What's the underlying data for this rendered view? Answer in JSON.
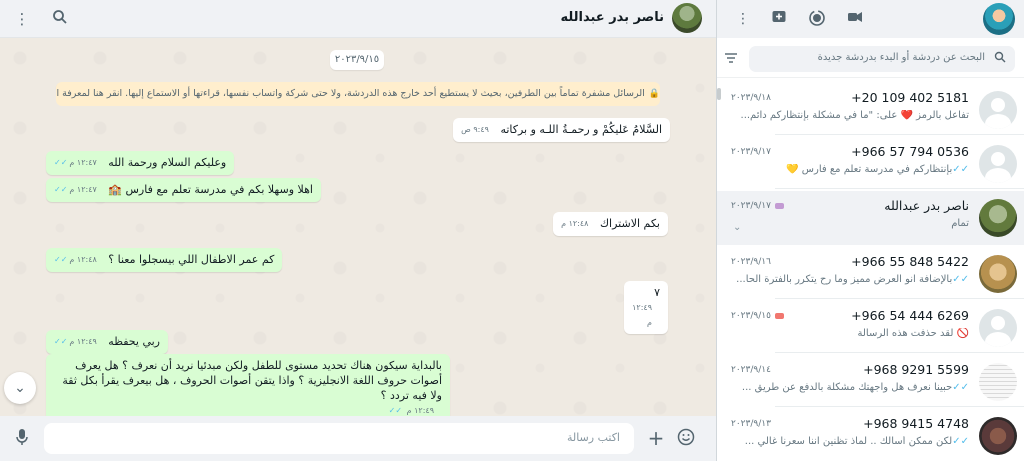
{
  "chat": {
    "contact_name": "ناصر بدر عبدالله",
    "date_chip": "٢٠٢٣/٩/١٥",
    "encryption_notice": "الرسائل مشفرة تماماً بين الطرفين، بحيث لا يستطيع أحد خارج هذه الدردشة، ولا حتى شركة واتساب نفسها، قراءتها أو الاستماع إليها. انقر هنا لمعرفة المزيد.",
    "messages": [
      {
        "dir": "in",
        "text": "السَّلامُ عَليكُمْ و رحمـةُ اللـه و بركاته",
        "time": "٩:٤٩ ص"
      },
      {
        "dir": "out",
        "text": "وعليكم السلام ورحمة الله",
        "time": "١٢:٤٧ م"
      },
      {
        "dir": "out",
        "text": "اهلا وسهلا بكم في مدرسة تعلم مع فارس 🏫",
        "time": "١٢:٤٧ م"
      },
      {
        "dir": "in",
        "text": "بكم الاشتراك",
        "time": "١٢:٤٨ م"
      },
      {
        "dir": "out",
        "text": "كم عمر الاطفال اللي بيسجلوا معنا ؟",
        "time": "١٢:٤٨ م"
      },
      {
        "dir": "in",
        "text": "٧",
        "time": "١٢:٤٩ م"
      },
      {
        "dir": "out",
        "text": "ربي يحفظه",
        "time": "١٢:٤٩ م"
      },
      {
        "dir": "out",
        "text": "بالبداية سيكون هناك تحديد مستوى للطفل ولكن مبدئيا نريد أن نعرف ؟ هل يعرف أصوات حروف اللغة الانجليزية ؟ واذا يتقن أصوات الحروف ، هل بيعرف يقرأ بكل ثقة ولا فيه تردد ؟",
        "time": "١٢:٤٩ م"
      }
    ],
    "composer_placeholder": "اكتب رسالة"
  },
  "list": {
    "search_placeholder": "البحث عن دردشة أو البدء بدردشة جديدة",
    "chats": [
      {
        "name": "+20 109 402 5181",
        "date": "٢٠٢٣/٩/١٨",
        "preview": "تفاعل بالرمز ❤️ على: \"ما في مشكلة بإنتظاركم دائم...",
        "tick": false,
        "avatar": "default",
        "tag": ""
      },
      {
        "name": "+966 57 794 0536",
        "date": "٢٠٢٣/٩/١٧",
        "preview": "بإنتظاركم في مدرسة تعلم مع فارس 💛",
        "tick": true,
        "avatar": "default",
        "tag": ""
      },
      {
        "name": "ناصر بدر عبدالله",
        "date": "٢٠٢٣/٩/١٧",
        "preview": "تمام",
        "tick": false,
        "avatar": "pic1",
        "tag": "#c39bd3",
        "active": true
      },
      {
        "name": "+966 55 848 5422",
        "date": "٢٠٢٣/٩/١٦",
        "preview": "بالإضافة انو العرض مميز وما رح يتكرر بالفترة الحا...",
        "tick": true,
        "avatar": "pic2",
        "tag": ""
      },
      {
        "name": "+966 54 444 6269",
        "date": "٢٠٢٣/٩/١٥",
        "preview": "🚫 لقد حذفت هذه الرسالة",
        "tick": false,
        "avatar": "default",
        "tag": "#f1776f"
      },
      {
        "name": "+968 9291 5599",
        "date": "٢٠٢٣/٩/١٤",
        "preview": "حبينا نعرف هل واجهتك مشكلة بالدفع عن طريق ...",
        "tick": true,
        "avatar": "pic3",
        "tag": ""
      },
      {
        "name": "+968 9415 4748",
        "date": "٢٠٢٣/٩/١٣",
        "preview": "لكن ممكن أسألك .. لماذ  تظنين اننا  سعرنا غالي ...",
        "tick": true,
        "avatar": "pic4",
        "tag": ""
      }
    ]
  },
  "colors": {
    "outgoing_bubble": "#d9fdd3",
    "incoming_bubble": "#ffffff",
    "read_tick": "#53bdeb",
    "chat_bg": "#efeae2"
  }
}
